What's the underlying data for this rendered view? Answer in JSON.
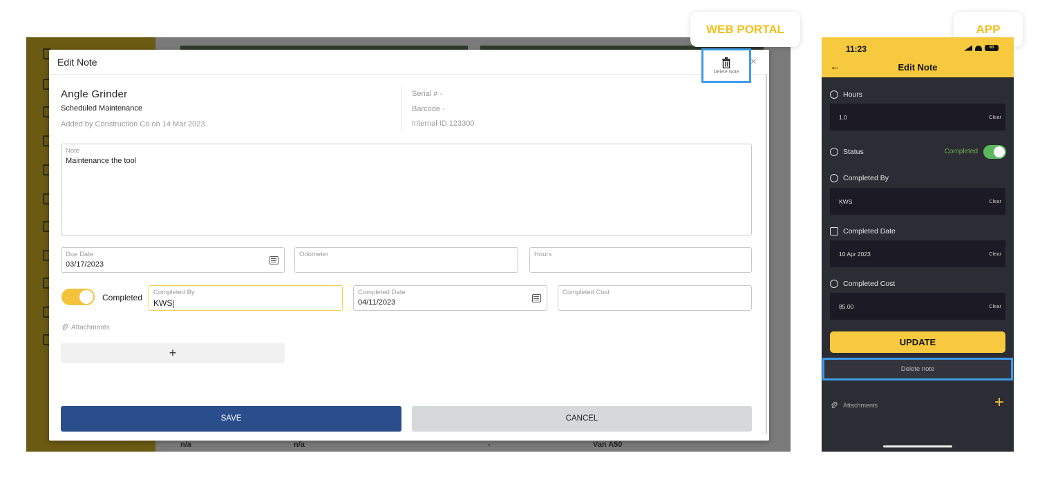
{
  "labels": {
    "web_portal": "WEB PORTAL",
    "app": "APP"
  },
  "web": {
    "modal_title": "Edit Note",
    "delete_label": "Delete Note",
    "close": "×",
    "asset": {
      "name": "Angle Grinder",
      "type": "Scheduled Maintenance",
      "added": "Added by Construction Co on 14 Mar 2023",
      "serial": "Serial # -",
      "barcode": "Barcode -",
      "internal_id": "Internal ID 123300"
    },
    "note": {
      "label": "Note",
      "value": "Maintenance the tool"
    },
    "due_date": {
      "label": "Due Date",
      "value": "03/17/2023"
    },
    "odometer": {
      "label": "Odometer",
      "value": ""
    },
    "hours": {
      "label": "Hours",
      "value": ""
    },
    "completed_toggle": {
      "label": "Completed",
      "on": true
    },
    "completed_by": {
      "label": "Completed By",
      "value": "KWS"
    },
    "completed_date": {
      "label": "Completed Date",
      "value": "04/11/2023"
    },
    "completed_cost": {
      "label": "Completed Cost",
      "value": ""
    },
    "attachments_label": "Attachments",
    "add_attachment": "+",
    "save": "SAVE",
    "cancel": "CANCEL",
    "bg_row": [
      "n/a",
      "n/a",
      "-",
      "Van A50"
    ]
  },
  "app": {
    "time": "11:23",
    "battery": "80",
    "title": "Edit Note",
    "back": "←",
    "hours": {
      "label": "Hours",
      "value": "1.0",
      "clear": "Clear"
    },
    "status": {
      "label": "Status",
      "value": "Completed",
      "on": true
    },
    "completed_by": {
      "label": "Completed By",
      "value": "KWS",
      "clear": "Clear"
    },
    "completed_date": {
      "label": "Completed Date",
      "value": "10 Apr 2023",
      "clear": "Clear"
    },
    "completed_cost": {
      "label": "Completed Cost",
      "value": "85.00",
      "clear": "Clear"
    },
    "update": "UPDATE",
    "delete": "Delete note",
    "attachments": "Attachments",
    "add": "+"
  },
  "colors": {
    "accent": "#f3c11c",
    "primary": "#2a4e8c",
    "highlight": "#3d9be9",
    "success": "#5cb85c"
  }
}
